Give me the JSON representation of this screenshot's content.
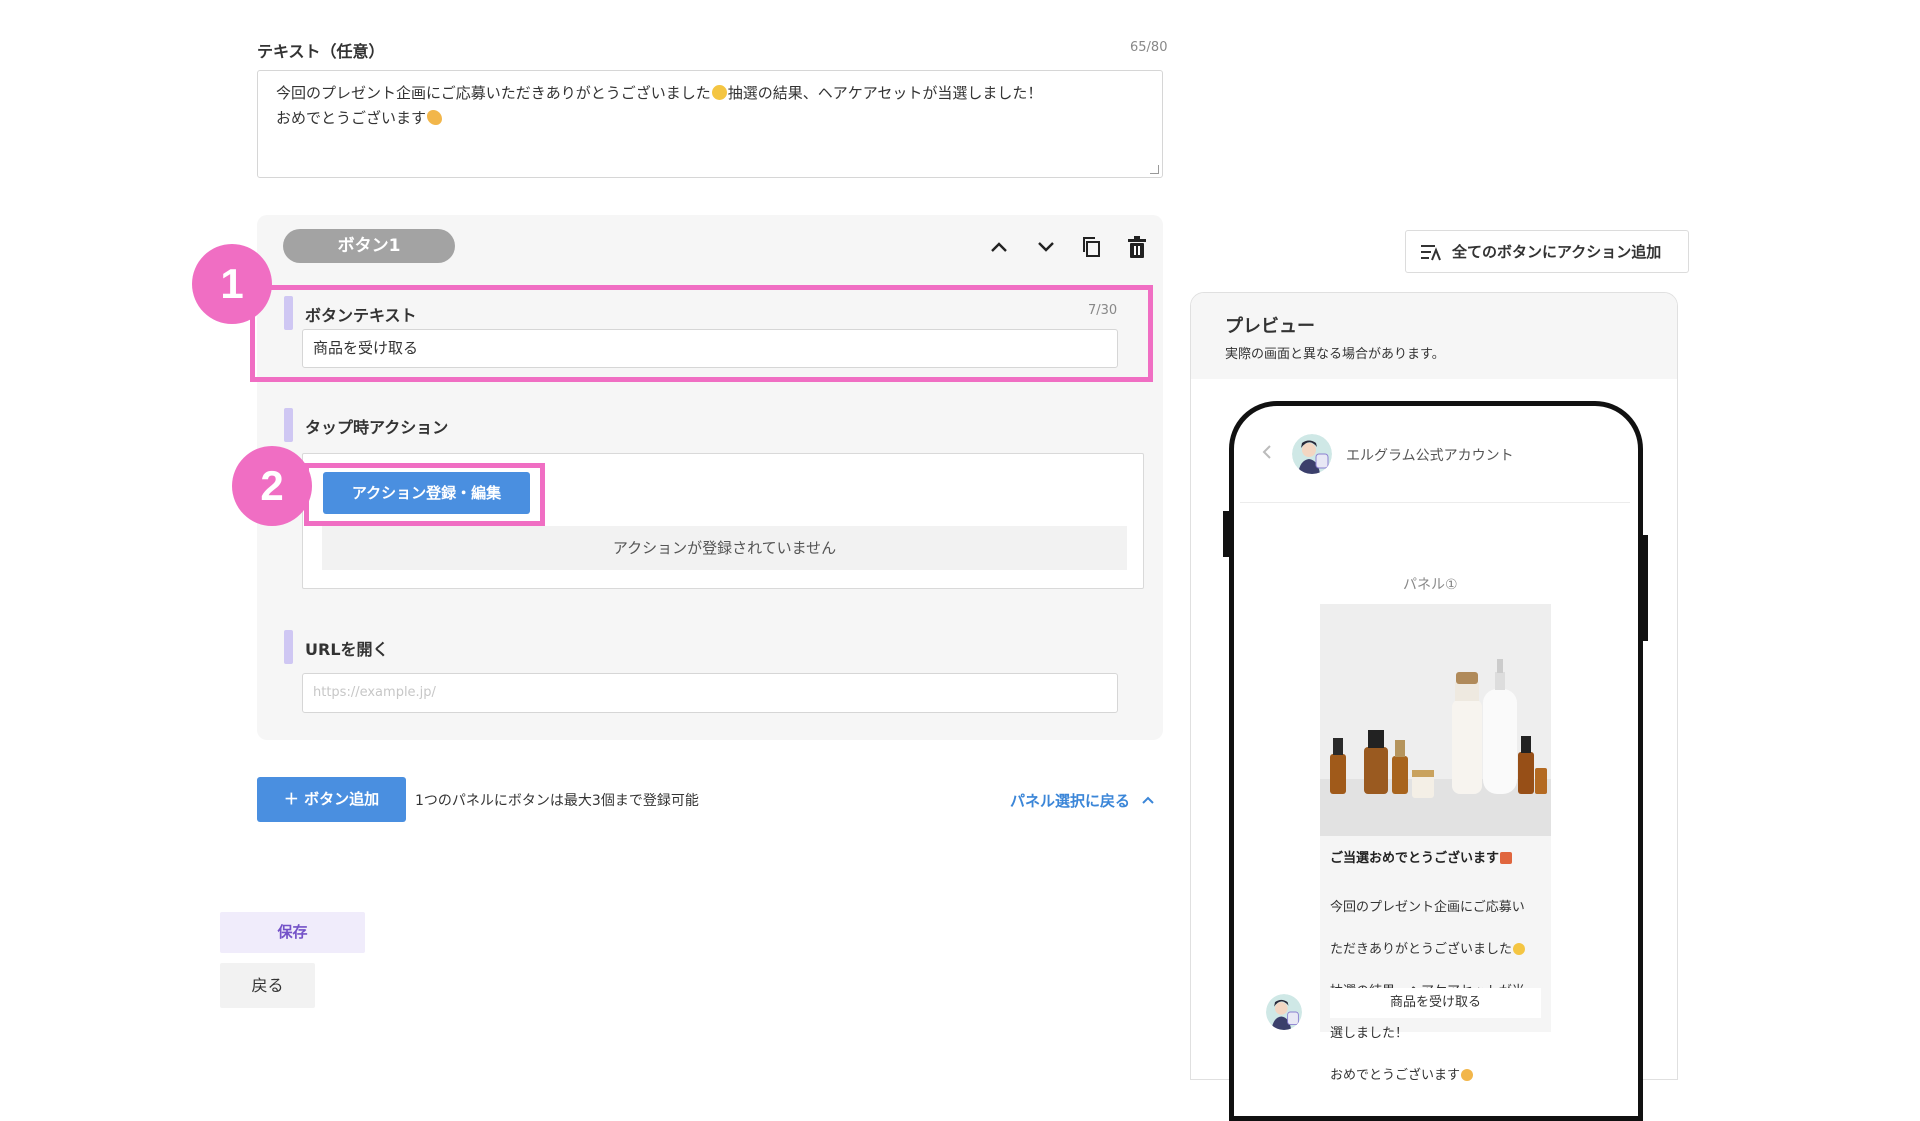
{
  "text_section": {
    "label": "テキスト（任意）",
    "counter": "65/80",
    "line1": "今回のプレゼント企画にご応募いただきありがとうございました",
    "line1_after": "抽選の結果、ヘアケアセットが当選しました！",
    "line2": "おめでとうございます"
  },
  "button_card": {
    "pill_label": "ボタン1",
    "controls": [
      "chevron-up-icon",
      "chevron-down-icon",
      "copy-icon",
      "trash-icon"
    ],
    "button_text_title": "ボタンテキスト",
    "button_text_counter": "7/30",
    "button_text_value": "商品を受け取る",
    "tap_action_title": "タップ時アクション",
    "action_button_label": "アクション登録・編集",
    "action_empty_text": "アクションが登録されていません",
    "url_title": "URLを開く",
    "url_placeholder": "https://example.jp/"
  },
  "annotations": {
    "badge1": "1",
    "badge2": "2",
    "highlight_color": "#f06ec3"
  },
  "footer": {
    "add_button_label": "＋ ボタン追加",
    "add_note": "1つのパネルにボタンは最大3個まで登録可能",
    "back_to_panel_label": "パネル選択に戻る"
  },
  "actions": {
    "save_label": "保存",
    "back_label": "戻る"
  },
  "right": {
    "all_actions_label": "全てのボタンにアクション追加",
    "preview_title": "プレビュー",
    "preview_subtitle": "実際の画面と異なる場合があります。",
    "chat_name": "エルグラム公式アカウント",
    "panel_label": "パネル①",
    "card_title": "ご当選おめでとうございます",
    "card_text_1": "今回のプレゼント企画にご応募い",
    "card_text_2": "ただきありがとうございました",
    "card_text_3": "抽選の結果、ヘアケアセットが当",
    "card_text_4": "選しました！",
    "card_text_5": "おめでとうございます",
    "card_button": "商品を受け取る"
  },
  "colors": {
    "primary_blue": "#4a8fe0",
    "link_blue": "#3b86d8",
    "section_bar": "#cfc7f3",
    "save_purple": "#7452c8"
  }
}
